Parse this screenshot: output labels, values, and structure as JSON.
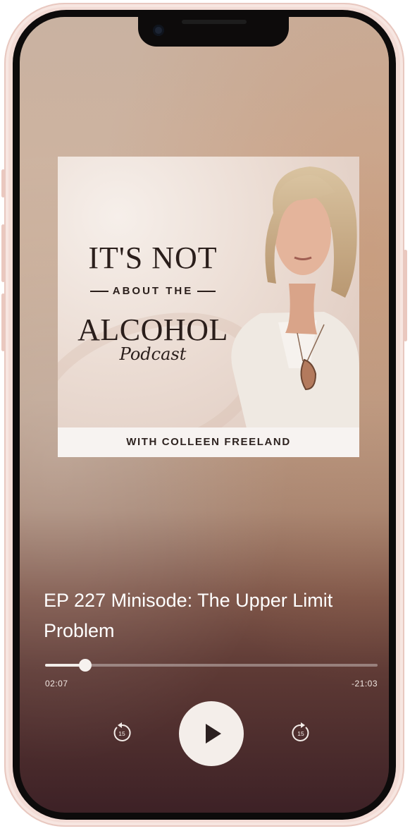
{
  "artwork": {
    "title_line1": "IT'S NOT",
    "title_line2": "ABOUT THE",
    "title_line3": "ALCOHOL",
    "title_line4": "Podcast",
    "footer": "WITH COLLEEN FREELAND"
  },
  "episode": {
    "title": "EP 227 Minisode: The Upper Limit Problem"
  },
  "player": {
    "elapsed": "02:07",
    "remaining": "-21:03",
    "progress": 0.12,
    "skip_back_label": "15",
    "skip_forward_label": "15"
  },
  "colors": {
    "control_bg": "#f4eeea",
    "play_icon": "#2b2020"
  }
}
